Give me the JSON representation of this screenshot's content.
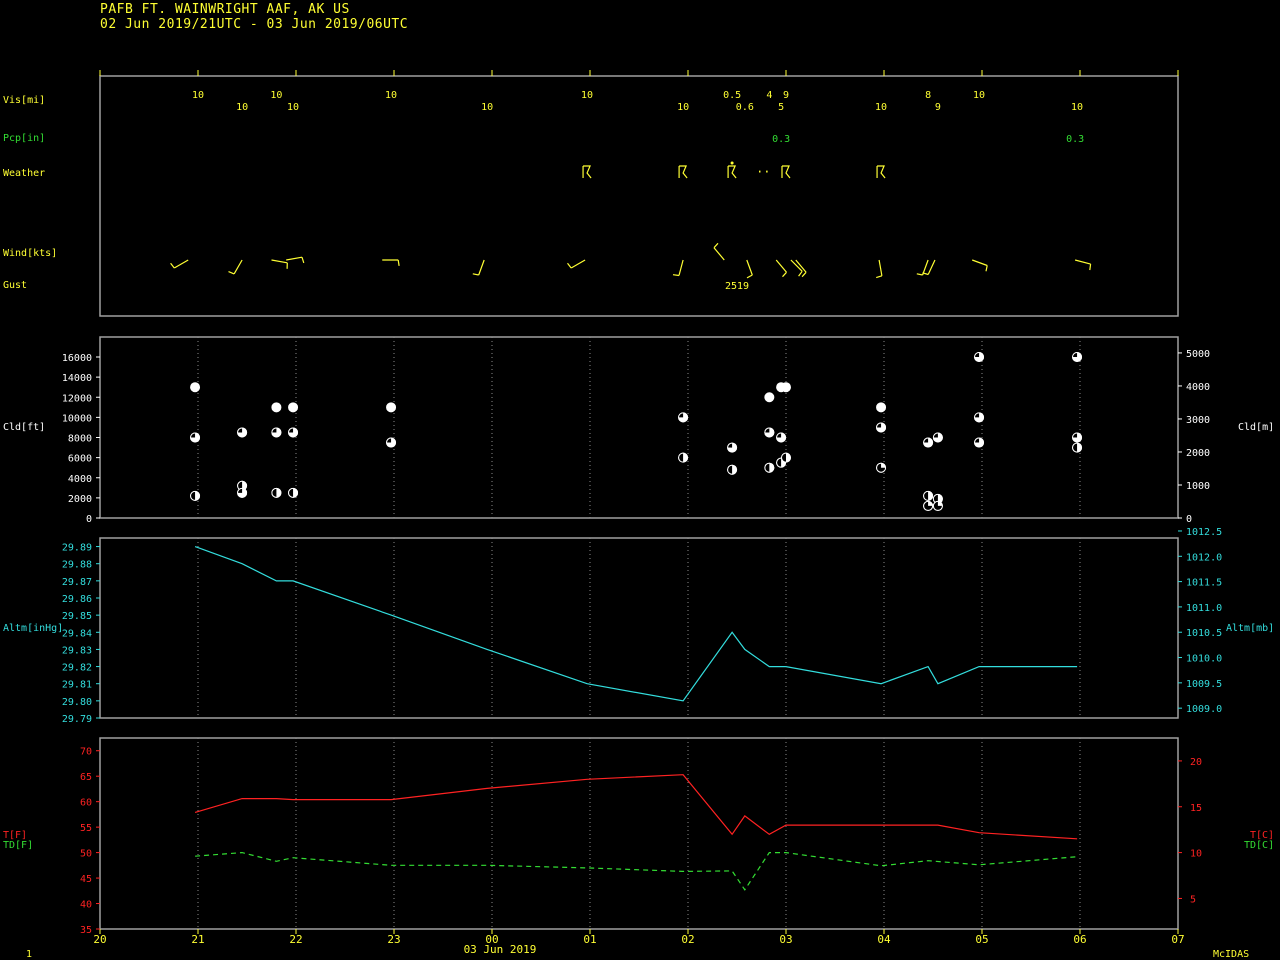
{
  "header": {
    "line1": "PAFB  FT. WAINWRIGHT AAF, AK US",
    "line2": "02 Jun 2019/21UTC - 03 Jun 2019/06UTC"
  },
  "footer": {
    "left": "1",
    "date": "03 Jun 2019",
    "brand": "McIDAS"
  },
  "colors": {
    "yellow": "#ffff33",
    "green": "#33dd33",
    "cyan": "#33dddd",
    "red": "#ff2222",
    "frame": "#a0a0a0",
    "white": "#ffffff"
  },
  "chart_data": [
    {
      "type": "table",
      "panel": "observations",
      "x_hours": [
        20,
        21,
        22,
        23,
        24,
        25,
        26,
        27,
        28,
        29,
        30,
        31
      ],
      "row_labels": {
        "vis": "Vis[mi]",
        "pcp": "Pcp[in]",
        "weather": "Weather",
        "wind": "Wind[kts]",
        "gust": "Gust"
      },
      "vis": [
        {
          "t": 21.0,
          "v": "10",
          "row": 0
        },
        {
          "t": 21.45,
          "v": "10",
          "row": 1
        },
        {
          "t": 21.8,
          "v": "10",
          "row": 0
        },
        {
          "t": 21.97,
          "v": "10",
          "row": 1
        },
        {
          "t": 22.97,
          "v": "10",
          "row": 0
        },
        {
          "t": 23.95,
          "v": "10",
          "row": 1
        },
        {
          "t": 24.97,
          "v": "10",
          "row": 0
        },
        {
          "t": 25.95,
          "v": "10",
          "row": 1
        },
        {
          "t": 26.45,
          "v": "0.5",
          "row": 0
        },
        {
          "t": 26.58,
          "v": "0.6",
          "row": 1
        },
        {
          "t": 26.83,
          "v": "4",
          "row": 0
        },
        {
          "t": 26.95,
          "v": "5",
          "row": 1
        },
        {
          "t": 27.0,
          "v": "9",
          "row": 0
        },
        {
          "t": 27.97,
          "v": "10",
          "row": 1
        },
        {
          "t": 28.45,
          "v": "8",
          "row": 0
        },
        {
          "t": 28.55,
          "v": "9",
          "row": 1
        },
        {
          "t": 28.97,
          "v": "10",
          "row": 0
        },
        {
          "t": 29.97,
          "v": "10",
          "row": 1
        }
      ],
      "pcp": [
        {
          "t": 26.95,
          "v": "0.3"
        },
        {
          "t": 29.95,
          "v": "0.3"
        }
      ],
      "weather": [
        {
          "t": 24.97,
          "sym": "ts"
        },
        {
          "t": 25.95,
          "sym": "ts"
        },
        {
          "t": 26.45,
          "sym": "tsra"
        },
        {
          "t": 26.85,
          "sym": "drizzle"
        },
        {
          "t": 27.0,
          "sym": "ts"
        },
        {
          "t": 27.97,
          "sym": "ts"
        }
      ],
      "wind": [
        {
          "t": 20.9,
          "dir": 240,
          "spd": 8
        },
        {
          "t": 21.45,
          "dir": 210,
          "spd": 8
        },
        {
          "t": 21.75,
          "dir": 100,
          "spd": 6
        },
        {
          "t": 21.9,
          "dir": 80,
          "spd": 8
        },
        {
          "t": 22.88,
          "dir": 90,
          "spd": 8
        },
        {
          "t": 23.92,
          "dir": 200,
          "spd": 8
        },
        {
          "t": 24.95,
          "dir": 240,
          "spd": 8
        },
        {
          "t": 25.95,
          "dir": 195,
          "spd": 8
        },
        {
          "t": 26.37,
          "dir": 320,
          "spd": 8
        },
        {
          "t": 26.6,
          "dir": 160,
          "spd": 8
        },
        {
          "t": 26.9,
          "dir": 140,
          "spd": 8
        },
        {
          "t": 27.05,
          "dir": 135,
          "spd": 10
        },
        {
          "t": 27.1,
          "dir": 140,
          "spd": 12
        },
        {
          "t": 27.95,
          "dir": 170,
          "spd": 8
        },
        {
          "t": 28.45,
          "dir": 200,
          "spd": 8
        },
        {
          "t": 28.52,
          "dir": 205,
          "spd": 8
        },
        {
          "t": 28.9,
          "dir": 110,
          "spd": 8
        },
        {
          "t": 29.95,
          "dir": 105,
          "spd": 8
        }
      ],
      "gust": [
        {
          "t": 26.5,
          "v": "2519"
        }
      ]
    },
    {
      "type": "scatter",
      "panel": "clouds",
      "ylabel_left": "Cld[ft]",
      "ylabel_right": "Cld[m]",
      "ylim": [
        0,
        16000
      ],
      "yticks": [
        0,
        2000,
        4000,
        6000,
        8000,
        10000,
        12000,
        14000,
        16000
      ],
      "yticks_right": [
        0,
        1000,
        2000,
        3000,
        4000,
        5000
      ],
      "points": [
        {
          "t": 20.97,
          "ft": 13000,
          "cov": "ovc"
        },
        {
          "t": 20.97,
          "ft": 8000,
          "cov": "bkn"
        },
        {
          "t": 20.97,
          "ft": 2200,
          "cov": "sct"
        },
        {
          "t": 21.45,
          "ft": 8500,
          "cov": "bkn"
        },
        {
          "t": 21.45,
          "ft": 3200,
          "cov": "sct"
        },
        {
          "t": 21.45,
          "ft": 2500,
          "cov": "bkn"
        },
        {
          "t": 21.8,
          "ft": 11000,
          "cov": "ovc"
        },
        {
          "t": 21.8,
          "ft": 8500,
          "cov": "bkn"
        },
        {
          "t": 21.8,
          "ft": 2500,
          "cov": "sct"
        },
        {
          "t": 21.97,
          "ft": 11000,
          "cov": "ovc"
        },
        {
          "t": 21.97,
          "ft": 8500,
          "cov": "bkn"
        },
        {
          "t": 21.97,
          "ft": 2500,
          "cov": "sct"
        },
        {
          "t": 22.97,
          "ft": 11000,
          "cov": "ovc"
        },
        {
          "t": 22.97,
          "ft": 7500,
          "cov": "bkn"
        },
        {
          "t": 25.95,
          "ft": 10000,
          "cov": "bkn"
        },
        {
          "t": 25.95,
          "ft": 6000,
          "cov": "sct"
        },
        {
          "t": 26.45,
          "ft": 7000,
          "cov": "bkn"
        },
        {
          "t": 26.45,
          "ft": 4800,
          "cov": "sct"
        },
        {
          "t": 26.83,
          "ft": 12000,
          "cov": "ovc"
        },
        {
          "t": 26.83,
          "ft": 8500,
          "cov": "bkn"
        },
        {
          "t": 26.83,
          "ft": 5000,
          "cov": "sct"
        },
        {
          "t": 26.95,
          "ft": 13000,
          "cov": "ovc"
        },
        {
          "t": 26.95,
          "ft": 8000,
          "cov": "bkn"
        },
        {
          "t": 26.95,
          "ft": 5500,
          "cov": "sct"
        },
        {
          "t": 27.0,
          "ft": 13000,
          "cov": "ovc"
        },
        {
          "t": 27.0,
          "ft": 6000,
          "cov": "sct"
        },
        {
          "t": 27.97,
          "ft": 11000,
          "cov": "ovc"
        },
        {
          "t": 27.97,
          "ft": 9000,
          "cov": "bkn"
        },
        {
          "t": 27.97,
          "ft": 5000,
          "cov": "few"
        },
        {
          "t": 28.45,
          "ft": 7500,
          "cov": "bkn"
        },
        {
          "t": 28.45,
          "ft": 2200,
          "cov": "sct"
        },
        {
          "t": 28.45,
          "ft": 1200,
          "cov": "few"
        },
        {
          "t": 28.55,
          "ft": 8000,
          "cov": "bkn"
        },
        {
          "t": 28.55,
          "ft": 1900,
          "cov": "sct"
        },
        {
          "t": 28.55,
          "ft": 1200,
          "cov": "few"
        },
        {
          "t": 28.97,
          "ft": 16000,
          "cov": "bkn"
        },
        {
          "t": 28.97,
          "ft": 10000,
          "cov": "bkn"
        },
        {
          "t": 28.97,
          "ft": 7500,
          "cov": "bkn"
        },
        {
          "t": 29.97,
          "ft": 16000,
          "cov": "bkn"
        },
        {
          "t": 29.97,
          "ft": 8000,
          "cov": "bkn"
        },
        {
          "t": 29.97,
          "ft": 7000,
          "cov": "sct"
        }
      ]
    },
    {
      "type": "line",
      "panel": "altimeter",
      "ylabel_left": "Altm[inHg]",
      "ylabel_right": "Altm[mb]",
      "ylim": [
        29.79,
        29.895
      ],
      "yticks": [
        "29.79",
        "29.80",
        "29.81",
        "29.82",
        "29.83",
        "29.84",
        "29.85",
        "29.86",
        "29.87",
        "29.88",
        "29.89"
      ],
      "yticks_right": [
        "1009.0",
        "1009.5",
        "1010.0",
        "1010.5",
        "1011.0",
        "1011.5",
        "1012.0",
        "1012.5"
      ],
      "x": [
        20.97,
        21.45,
        21.8,
        21.97,
        22.97,
        23.95,
        24.97,
        25.95,
        26.45,
        26.58,
        26.83,
        27.0,
        27.97,
        28.45,
        28.55,
        28.97,
        29.97
      ],
      "values": [
        29.89,
        29.88,
        29.87,
        29.87,
        29.85,
        29.83,
        29.81,
        29.8,
        29.84,
        29.83,
        29.82,
        29.82,
        29.81,
        29.82,
        29.81,
        29.82,
        29.82
      ]
    },
    {
      "type": "line",
      "panel": "temperature",
      "ylabel_left_t": "T[F]",
      "ylabel_left_td": "TD[F]",
      "ylabel_right_t": "T[C]",
      "ylabel_right_td": "TD[C]",
      "ylim": [
        35,
        72.5
      ],
      "yticks": [
        "35",
        "40",
        "45",
        "50",
        "55",
        "60",
        "65",
        "70"
      ],
      "yticks_right": [
        "5",
        "10",
        "15",
        "20"
      ],
      "series": [
        {
          "key": "temp",
          "x": [
            20.97,
            21.45,
            21.8,
            21.97,
            22.97,
            23.95,
            24.97,
            25.95,
            26.45,
            26.58,
            26.83,
            27.0,
            27.97,
            28.55,
            28.97,
            29.97
          ],
          "values": [
            57.9,
            60.6,
            60.6,
            60.4,
            60.4,
            62.6,
            64.4,
            65.3,
            53.6,
            57.2,
            53.6,
            55.4,
            55.4,
            55.4,
            53.9,
            52.7
          ]
        },
        {
          "key": "dewpoint",
          "x": [
            20.97,
            21.45,
            21.8,
            21.97,
            22.97,
            23.95,
            24.97,
            25.95,
            26.45,
            26.58,
            26.83,
            27.0,
            27.97,
            28.45,
            28.97,
            29.97
          ],
          "values": [
            49.3,
            50.0,
            48.3,
            49.0,
            47.5,
            47.5,
            47.0,
            46.3,
            46.4,
            42.7,
            50.0,
            50.0,
            47.4,
            48.4,
            47.6,
            49.2
          ]
        }
      ]
    }
  ],
  "x_axis": {
    "ticks": [
      {
        "t": 20,
        "label": "20"
      },
      {
        "t": 21,
        "label": "21"
      },
      {
        "t": 22,
        "label": "22"
      },
      {
        "t": 23,
        "label": "23"
      },
      {
        "t": 24,
        "label": "00"
      },
      {
        "t": 25,
        "label": "01"
      },
      {
        "t": 26,
        "label": "02"
      },
      {
        "t": 27,
        "label": "03"
      },
      {
        "t": 28,
        "label": "04"
      },
      {
        "t": 29,
        "label": "05"
      },
      {
        "t": 30,
        "label": "06"
      },
      {
        "t": 31,
        "label": "07"
      }
    ]
  }
}
